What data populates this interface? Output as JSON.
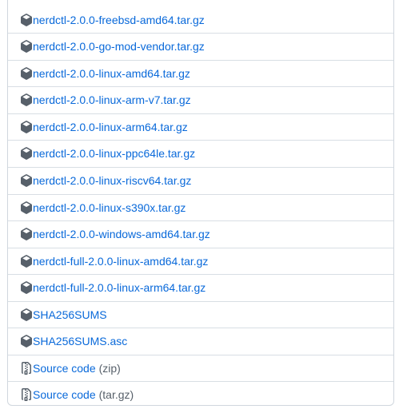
{
  "assets": [
    {
      "name": "nerdctl-2.0.0-freebsd-amd64.tar.gz",
      "icon": "package-icon"
    },
    {
      "name": "nerdctl-2.0.0-go-mod-vendor.tar.gz",
      "icon": "package-icon"
    },
    {
      "name": "nerdctl-2.0.0-linux-amd64.tar.gz",
      "icon": "package-icon"
    },
    {
      "name": "nerdctl-2.0.0-linux-arm-v7.tar.gz",
      "icon": "package-icon"
    },
    {
      "name": "nerdctl-2.0.0-linux-arm64.tar.gz",
      "icon": "package-icon"
    },
    {
      "name": "nerdctl-2.0.0-linux-ppc64le.tar.gz",
      "icon": "package-icon"
    },
    {
      "name": "nerdctl-2.0.0-linux-riscv64.tar.gz",
      "icon": "package-icon"
    },
    {
      "name": "nerdctl-2.0.0-linux-s390x.tar.gz",
      "icon": "package-icon"
    },
    {
      "name": "nerdctl-2.0.0-windows-amd64.tar.gz",
      "icon": "package-icon"
    },
    {
      "name": "nerdctl-full-2.0.0-linux-amd64.tar.gz",
      "icon": "package-icon"
    },
    {
      "name": "nerdctl-full-2.0.0-linux-arm64.tar.gz",
      "icon": "package-icon"
    },
    {
      "name": "SHA256SUMS",
      "icon": "package-icon"
    },
    {
      "name": "SHA256SUMS.asc",
      "icon": "package-icon"
    }
  ],
  "source_code": [
    {
      "label": "Source code",
      "format": "(zip)",
      "icon": "file-zip-icon"
    },
    {
      "label": "Source code",
      "format": "(tar.gz)",
      "icon": "file-zip-icon"
    }
  ],
  "colors": {
    "link": "#0969da",
    "muted": "#57606a",
    "border": "#d0d7de",
    "icon": "#57606a"
  }
}
